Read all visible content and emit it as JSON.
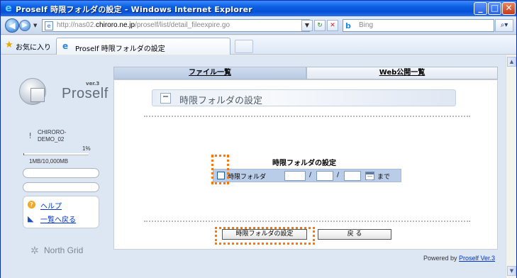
{
  "window": {
    "title": "Proself 時限フォルダの設定 - Windows Internet Explorer",
    "min_glyph": "_",
    "max_glyph": "□",
    "close_glyph": "✕"
  },
  "address": {
    "url_prefix": "http://nas02.",
    "url_host": "chiroro.ne.jp",
    "url_suffix": "/proself/list/detail_fileexpire.go",
    "search_placeholder": "Bing"
  },
  "favorites": {
    "label": "お気に入り",
    "tab_title": "Proself 時限フォルダの設定"
  },
  "sidebar": {
    "version": "ver.3",
    "logo_text": "Proself",
    "user": "CHIRORO-\nDEMO_02",
    "quota_percent": 1,
    "quota_percent_label": "1%",
    "quota_usage": "1MB/10,000MB",
    "help_label": "ヘルプ",
    "back_label": "一覧へ戻る",
    "vendor": "North Grid"
  },
  "tabs": {
    "files": "ファイル一覧",
    "web": "Web公開一覧"
  },
  "main": {
    "heading": "時限フォルダの設定",
    "form_title": "時限フォルダの設定",
    "checkbox_label": "時限フォルダ",
    "date_sep": "/",
    "until_label": "まで",
    "submit_label": "時限フォルダの設定",
    "back_label": "戻 る"
  },
  "footer": {
    "powered_prefix": "Powered by ",
    "powered_link": "Proself Ver.3"
  },
  "colors": {
    "highlight": "#ff7700",
    "link": "#0033cc",
    "quota_fill": "#d03030"
  }
}
